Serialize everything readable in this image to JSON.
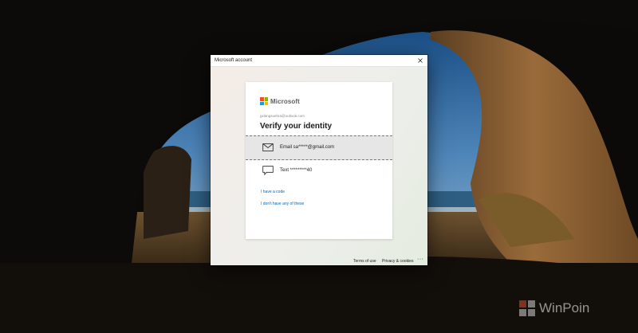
{
  "window": {
    "title": "Microsoft account",
    "close_glyph": "✕"
  },
  "card": {
    "brand": "Microsoft",
    "account": "gxlangsuehra@outlook.com",
    "heading": "Verify your identity",
    "options": [
      {
        "icon": "envelope-icon",
        "label": "Email sa*****@gmail.com",
        "selected": true
      },
      {
        "icon": "chat-bubble-icon",
        "label": "Text *********40",
        "selected": false
      }
    ],
    "links": {
      "have_code": "I have a code",
      "none": "I don't have any of these"
    }
  },
  "footer": {
    "terms": "Terms of use",
    "privacy": "Privacy & cookies",
    "more": "···"
  },
  "watermark": {
    "text": "WinPoin",
    "logo": "winpoin-logo"
  },
  "colors": {
    "ms_red": "#f25022",
    "ms_green": "#7fba00",
    "ms_blue": "#00a4ef",
    "ms_yellow": "#ffb900",
    "link": "#0067b8",
    "selected_row": "#e6e6e6"
  }
}
